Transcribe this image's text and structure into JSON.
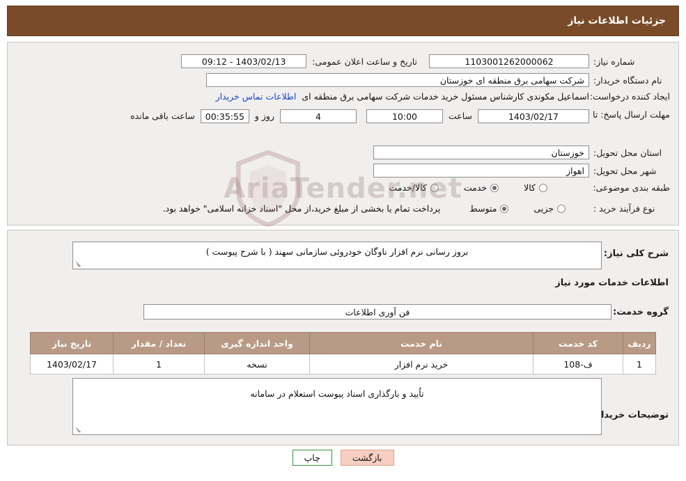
{
  "header": {
    "title": "جزئیات اطلاعات نیاز"
  },
  "form": {
    "need_number_label": "شماره نیاز:",
    "need_number_value": "1103001262000062",
    "announce_datetime_label": "تاریخ و ساعت اعلان عمومی:",
    "announce_datetime_value": "1403/02/13 - 09:12",
    "buyer_org_label": "نام دستگاه خریدار:",
    "buyer_org_value": "شرکت سهامی برق منطقه ای خوزستان",
    "requester_label": "ایجاد کننده درخواست:",
    "requester_value": "اسماعیل مکوندی کارشناس مسئول خرید خدمات شرکت سهامی برق منطقه ای",
    "contact_link": "اطلاعات تماس خریدار",
    "deadline_label": "مهلت ارسال پاسخ: تا تاریخ:",
    "deadline_date": "1403/02/17",
    "hour_label": "ساعت",
    "deadline_time": "10:00",
    "days_value": "4",
    "days_label": "روز و",
    "remaining_time": "00:35:55",
    "remaining_label": "ساعت باقی مانده",
    "province_label": "استان محل تحویل:",
    "province_value": "خوزستان",
    "city_label": "شهر محل تحویل:",
    "city_value": "اهواز",
    "category_label": "طبقه بندی موضوعی:",
    "category_options": [
      {
        "label": "کالا",
        "checked": false
      },
      {
        "label": "خدمت",
        "checked": true
      },
      {
        "label": "کالا/خدمت",
        "checked": false
      }
    ],
    "process_label": "نوع فرآیند خرید :",
    "process_options": [
      {
        "label": "جزیی",
        "checked": false
      },
      {
        "label": "متوسط",
        "checked": true
      }
    ],
    "payment_note": "پرداخت تمام یا بخشی از مبلغ خرید،از محل \"اسناد خزانه اسلامی\" خواهد بود."
  },
  "details": {
    "general_desc_label": "شرح کلی نیاز:",
    "general_desc_value": "بروز رسانی نرم افزار ناوگان خودروئی سازمانی سهند ( با شرح پیوست )",
    "services_heading": "اطلاعات خدمات مورد نیاز",
    "service_group_label": "گروه خدمت:",
    "service_group_value": "فن آوری اطلاعات",
    "table": {
      "headers": [
        "ردیف",
        "کد خدمت",
        "نام خدمت",
        "واحد اندازه گیری",
        "تعداد / مقدار",
        "تاریخ نیاز"
      ],
      "rows": [
        {
          "index": "1",
          "code": "ف-108",
          "name": "خرید نرم افزار",
          "unit": "نسخه",
          "qty": "1",
          "date": "1403/02/17"
        }
      ]
    },
    "buyer_notes_label": "توضیحات خریدار:",
    "buyer_notes_value": "تاُیید و بارگذاری اسناد پیوست استعلام در سامانه"
  },
  "footer": {
    "print_label": "چاپ",
    "back_label": "بازگشت"
  },
  "watermark": {
    "text": "AriaTender.net"
  },
  "colors": {
    "header_bg": "#7a4b28",
    "panel_bg": "#f0efed",
    "table_header_bg": "#b99a86",
    "link": "#1a42cf",
    "back_btn_bg": "#f6cfc2"
  }
}
